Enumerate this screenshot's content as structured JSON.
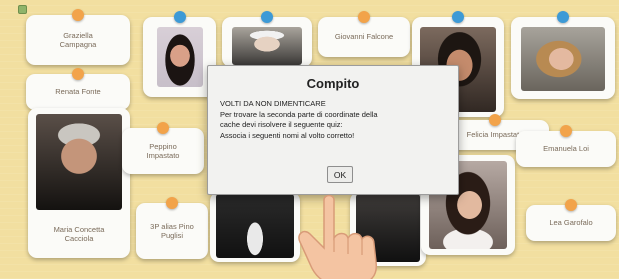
{
  "cards": {
    "graziella": "Graziella Campagna",
    "renata": "Renata Fonte",
    "giovanni": "Giovanni Falcone",
    "peppino": "Peppino Impastato",
    "felicia": "Felicia Impastato",
    "rossella": "Emanuela Loi",
    "maria": "Maria Concetta Cacciola",
    "puglisi": "3P alias Pino Puglisi",
    "lea": "Lea Garofalo"
  },
  "dialog": {
    "title": "Compito",
    "heading": "VOLTI DA NON DIMENTICARE",
    "line1": "Per trovare la seconda parte di coordinate della",
    "line2": "cache devi risolvere il seguente quiz:",
    "line3": "Associa i seguenti nomi al volto corretto!",
    "ok": "OK"
  },
  "colors": {
    "pin_orange": "#f2a34a",
    "pin_blue": "#3d9ad6",
    "board": "#f2dfa0"
  },
  "icons": {
    "pointer": "hand-pointer-icon",
    "pin": "pushpin-icon"
  }
}
